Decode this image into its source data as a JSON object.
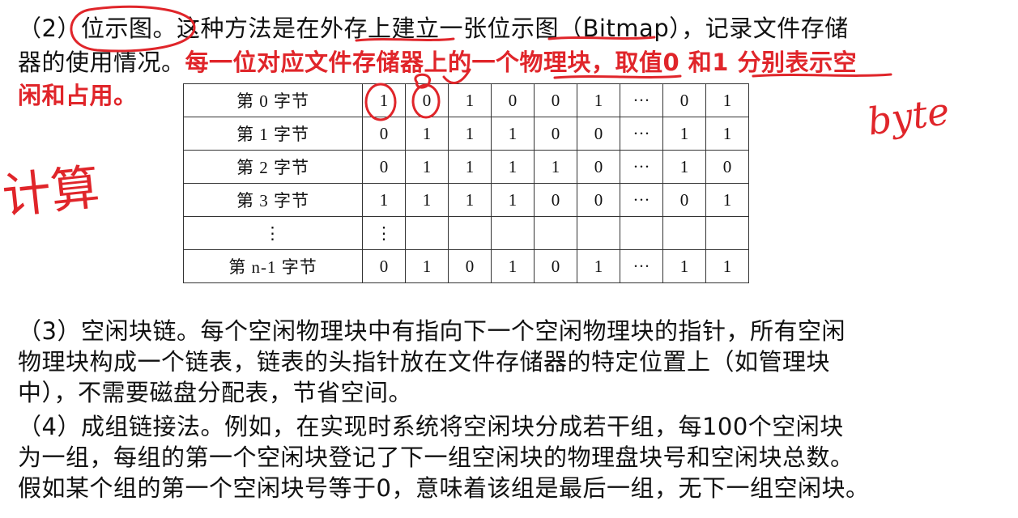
{
  "p2": {
    "l1_a": "（2）",
    "l1_term": "位示图",
    "l1_b": "。这种方法是在外存上建立一张位示图（Bitmap），记录文件存储",
    "l2_a": "器的使用情况。",
    "l2_red": "每一位对应文件存储器上的一个物理块，取值0 和1 分别表示空",
    "l3_red": "闲和占用。"
  },
  "table": {
    "rows": [
      {
        "label": "第 0 字节",
        "cells": [
          "1",
          "0",
          "1",
          "0",
          "0",
          "1",
          "···",
          "0",
          "1"
        ]
      },
      {
        "label": "第 1 字节",
        "cells": [
          "0",
          "1",
          "1",
          "1",
          "0",
          "0",
          "···",
          "1",
          "1"
        ]
      },
      {
        "label": "第 2 字节",
        "cells": [
          "0",
          "1",
          "1",
          "1",
          "1",
          "0",
          "···",
          "1",
          "0"
        ]
      },
      {
        "label": "第 3 字节",
        "cells": [
          "1",
          "1",
          "1",
          "1",
          "0",
          "0",
          "···",
          "0",
          "1"
        ]
      },
      {
        "label": "⋮",
        "cells": [
          "⋮",
          "",
          "",
          "",
          "",
          "",
          "",
          "",
          ""
        ]
      },
      {
        "label": "第 n-1 字节",
        "cells": [
          "0",
          "1",
          "0",
          "1",
          "0",
          "1",
          "···",
          "1",
          "1"
        ]
      }
    ]
  },
  "p3": {
    "l1": "（3）空闲块链。每个空闲物理块中有指向下一个空闲物理块的指针，所有空闲",
    "l2": "物理块构成一个链表，链表的头指针放在文件存储器的特定位置上（如管理块",
    "l3": "中），不需要磁盘分配表，节省空间。"
  },
  "p4": {
    "l1": "（4）成组链接法。例如，在实现时系统将空闲块分成若干组，每100个空闲块",
    "l2": "为一组，每组的第一个空闲块登记了下一组空闲块的物理盘块号和空闲块总数。",
    "l3": "假如某个组的第一个空闲块号等于0，意味着该组是最后一组，无下一组空闲块。"
  },
  "handwriting": {
    "left_note": "计算",
    "right_note": "byte",
    "ink_color": "#e0252a"
  }
}
